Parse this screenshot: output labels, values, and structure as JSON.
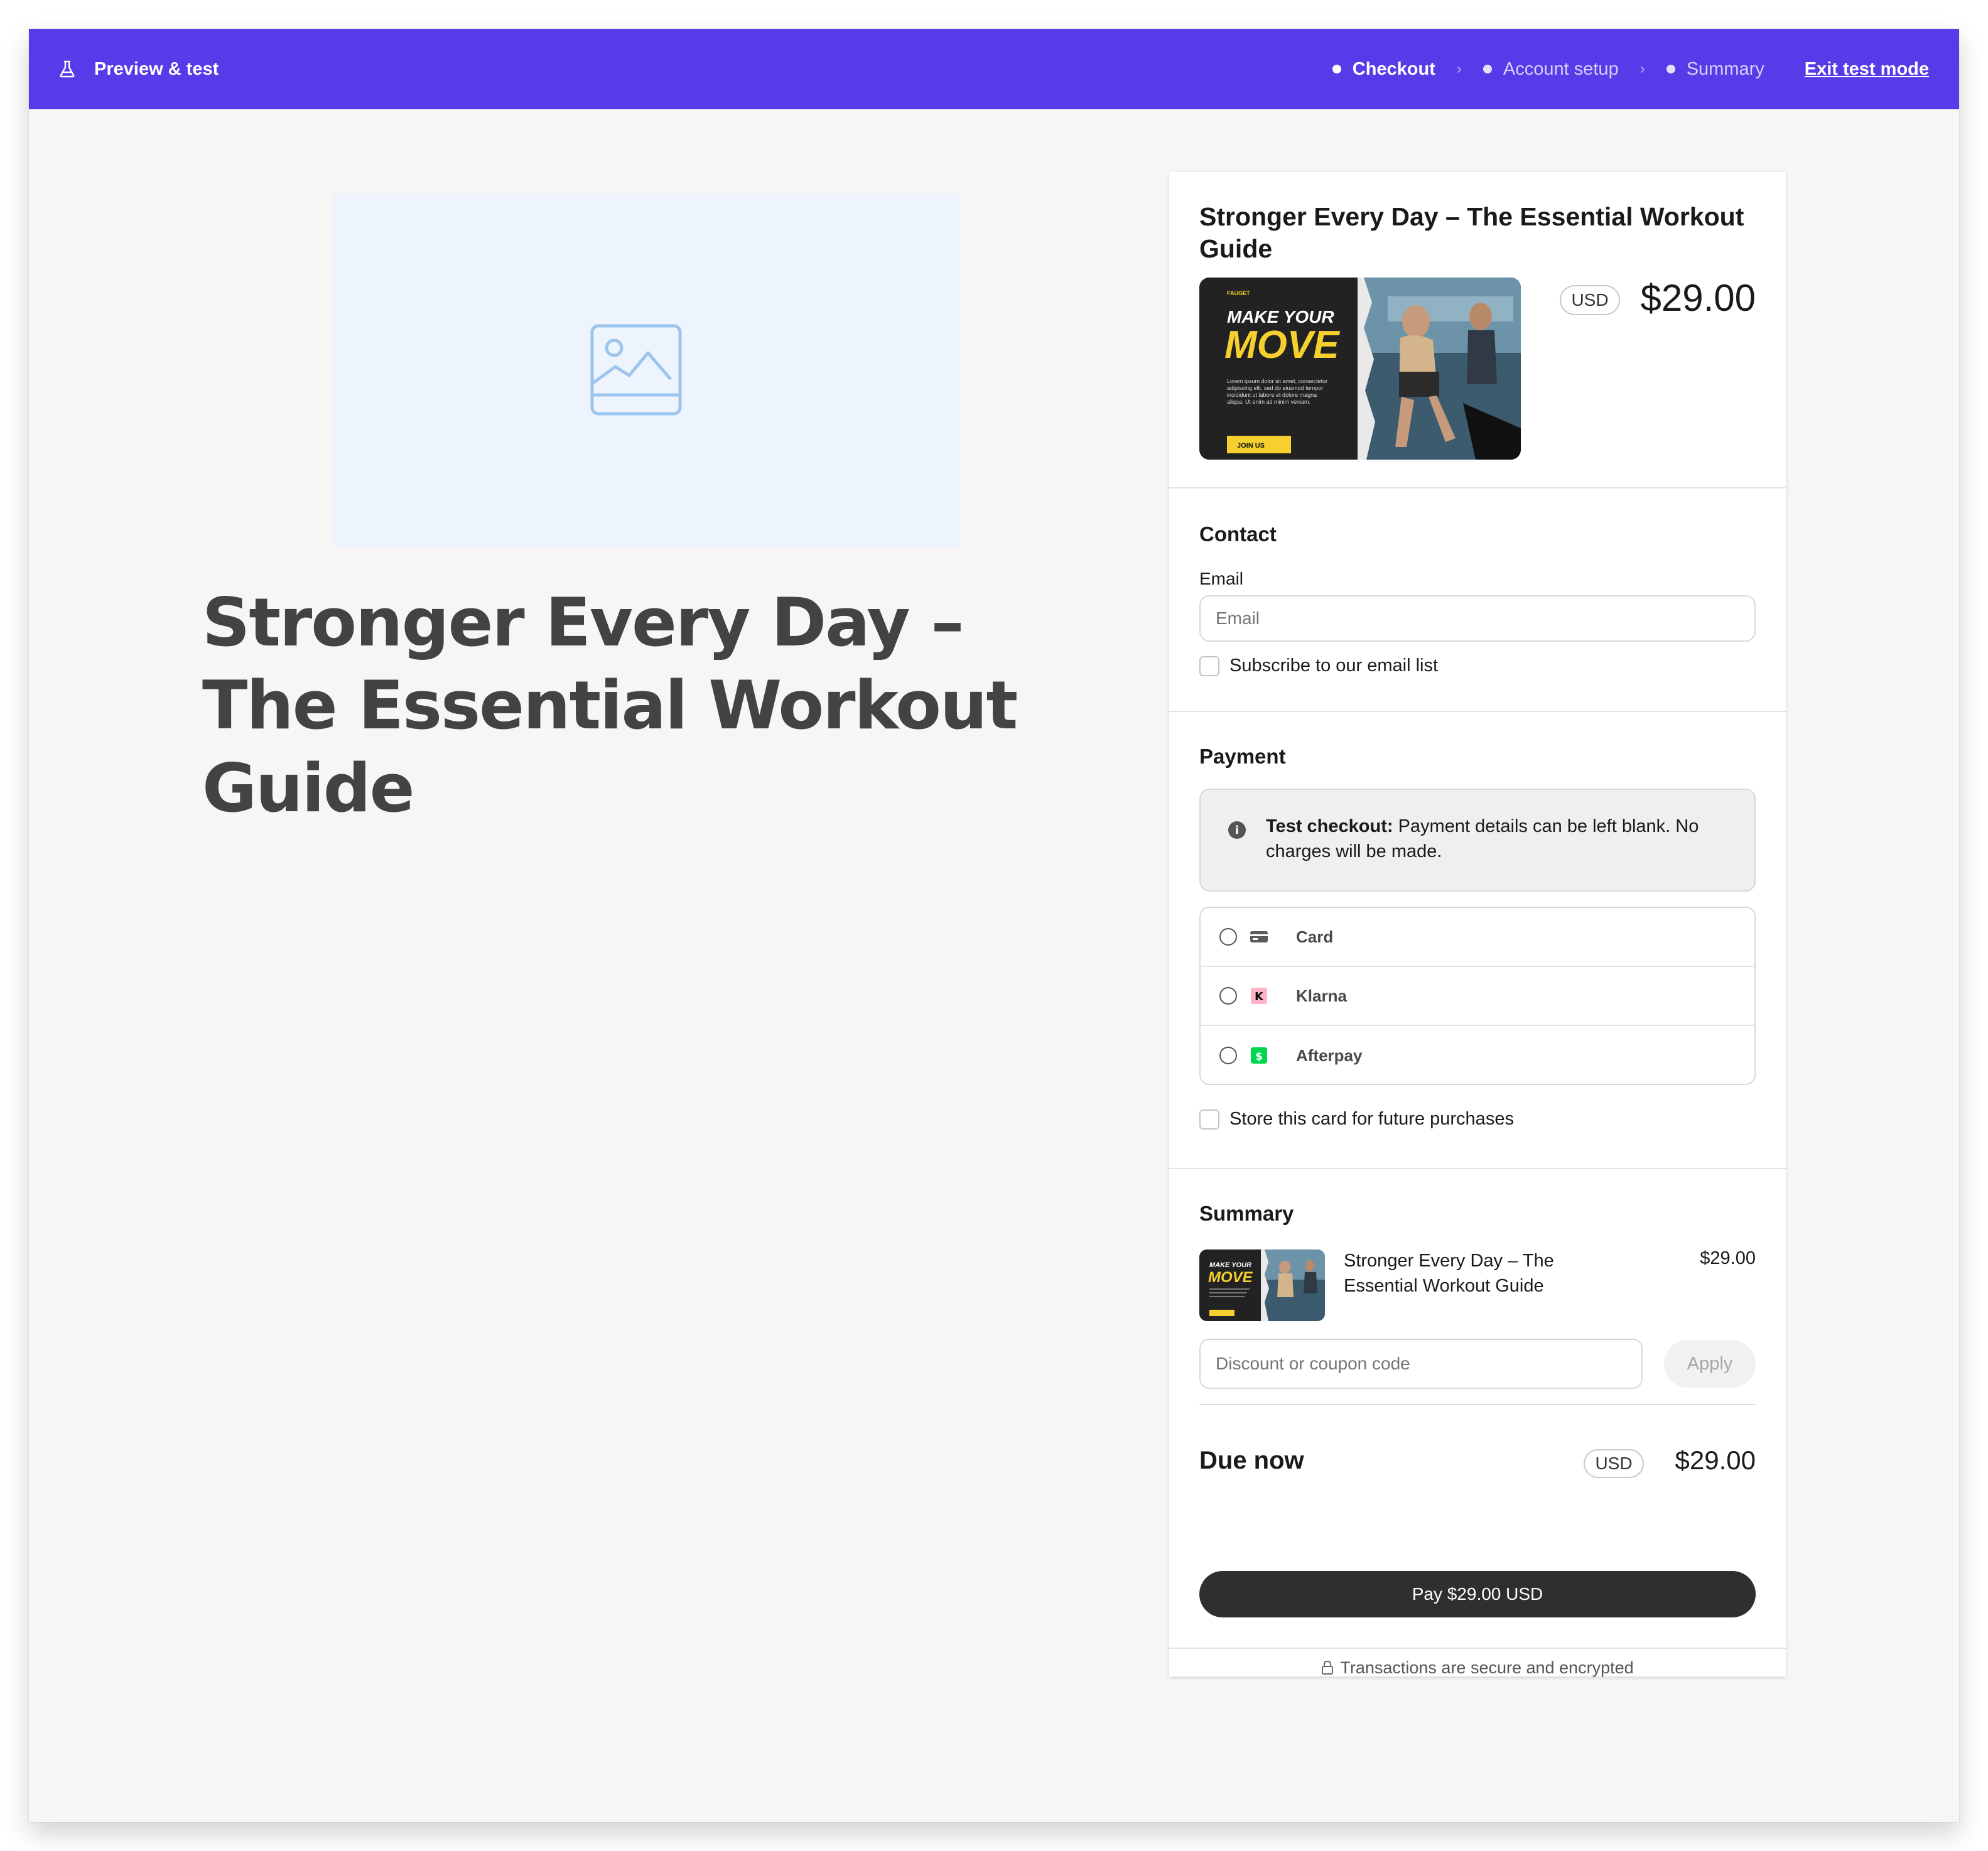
{
  "topbar": {
    "brand_label": "Preview & test",
    "steps": [
      {
        "label": "Checkout",
        "active": true
      },
      {
        "label": "Account setup",
        "active": false
      },
      {
        "label": "Summary",
        "active": false
      }
    ],
    "exit_label": "Exit test mode",
    "background": "#563be8"
  },
  "hero": {
    "title": "Stronger Every Day – The Essential Workout Guide",
    "image_icon": "image-placeholder-icon"
  },
  "product": {
    "title": "Stronger Every Day – The Essential Workout Guide",
    "currency": "USD",
    "price": "$29.00",
    "thumb": {
      "brand": "FAUGET",
      "headline_1": "MAKE YOUR",
      "headline_2": "MOVE",
      "body": "Lorem ipsum dolor sit amet, consectetur adipiscing elit, sed do eiusmod tempor incididunt ut labore et dolore magna aliqua. Ut enim ad minim veniam.",
      "cta": "JOIN US"
    }
  },
  "contact": {
    "title": "Contact",
    "email_label": "Email",
    "email_placeholder": "Email",
    "email_value": "",
    "subscribe_label": "Subscribe to our email list"
  },
  "payment": {
    "title": "Payment",
    "notice_bold": "Test checkout:",
    "notice_text": "Payment details can be left blank. No charges will be made.",
    "methods": [
      {
        "label": "Card",
        "icon": "card-icon"
      },
      {
        "label": "Klarna",
        "icon": "klarna-icon"
      },
      {
        "label": "Afterpay",
        "icon": "afterpay-icon"
      }
    ],
    "store_card_label": "Store this card for future purchases"
  },
  "summary": {
    "title": "Summary",
    "item_name": "Stronger Every Day – The Essential Workout Guide",
    "item_price": "$29.00",
    "coupon_placeholder": "Discount or coupon code",
    "apply_label": "Apply",
    "due_label": "Due now",
    "due_currency": "USD",
    "due_price": "$29.00"
  },
  "pay_button_label": "Pay $29.00 USD",
  "secure_text": "Transactions are secure and encrypted",
  "colors": {
    "accent": "#563be8",
    "pay_button": "#2f2f2f",
    "hero_image_bg": "#edf4fd",
    "klarna": "#ffb3c7",
    "afterpay": "#00d64f",
    "thumb_yellow": "#f5d02e"
  }
}
